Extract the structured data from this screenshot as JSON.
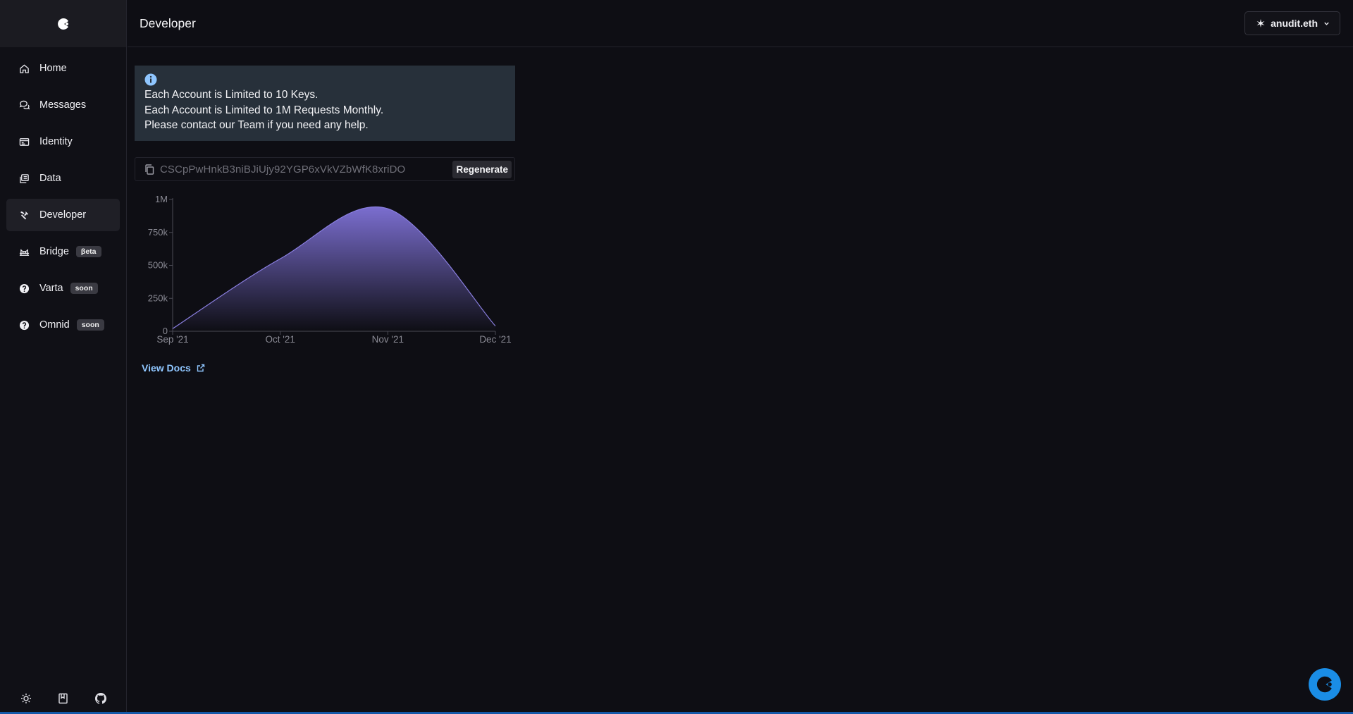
{
  "sidebar": {
    "items": [
      {
        "label": "Home",
        "icon": "home-icon",
        "active": false,
        "badge": ""
      },
      {
        "label": "Messages",
        "icon": "messages-icon",
        "active": false,
        "badge": ""
      },
      {
        "label": "Identity",
        "icon": "identity-icon",
        "active": false,
        "badge": ""
      },
      {
        "label": "Data",
        "icon": "data-icon",
        "active": false,
        "badge": ""
      },
      {
        "label": "Developer",
        "icon": "hammer-icon",
        "active": true,
        "badge": ""
      },
      {
        "label": "Bridge",
        "icon": "bridge-icon",
        "active": false,
        "badge": "βeta"
      },
      {
        "label": "Varta",
        "icon": "question-icon",
        "active": false,
        "badge": "soon"
      },
      {
        "label": "Omnid",
        "icon": "question-icon",
        "active": false,
        "badge": "soon"
      }
    ],
    "footer_icons": [
      "sun-icon",
      "book-icon",
      "github-icon"
    ]
  },
  "header": {
    "title": "Developer",
    "account_name": "anudit.eth"
  },
  "info": {
    "lines": [
      "Each Account is Limited to 10 Keys.",
      "Each Account is Limited to 1M Requests Monthly.",
      "Please contact our Team if you need any help."
    ]
  },
  "api_key": {
    "value": "CSCpPwHnkB3niBJiUjy92YGP6xVkVZbWfK8xriDO",
    "regenerate_label": "Regenerate"
  },
  "chart_data": {
    "type": "area",
    "x": [
      "Sep '21",
      "Oct '21",
      "Nov '21",
      "Dec '21"
    ],
    "series": [
      {
        "values": [
          20000,
          550000,
          930000,
          40000
        ]
      }
    ],
    "y_ticks": [
      "0",
      "250k",
      "500k",
      "750k",
      "1M"
    ],
    "ylim": [
      0,
      1000000
    ],
    "grid": false,
    "colors": {
      "fill_top": "#7b6ed0",
      "stroke": "#8a7fe0"
    }
  },
  "docs": {
    "label": "View Docs"
  },
  "colors": {
    "accent": "#1a8de6",
    "link": "#8fc6ff",
    "info_bg": "#27303a"
  }
}
